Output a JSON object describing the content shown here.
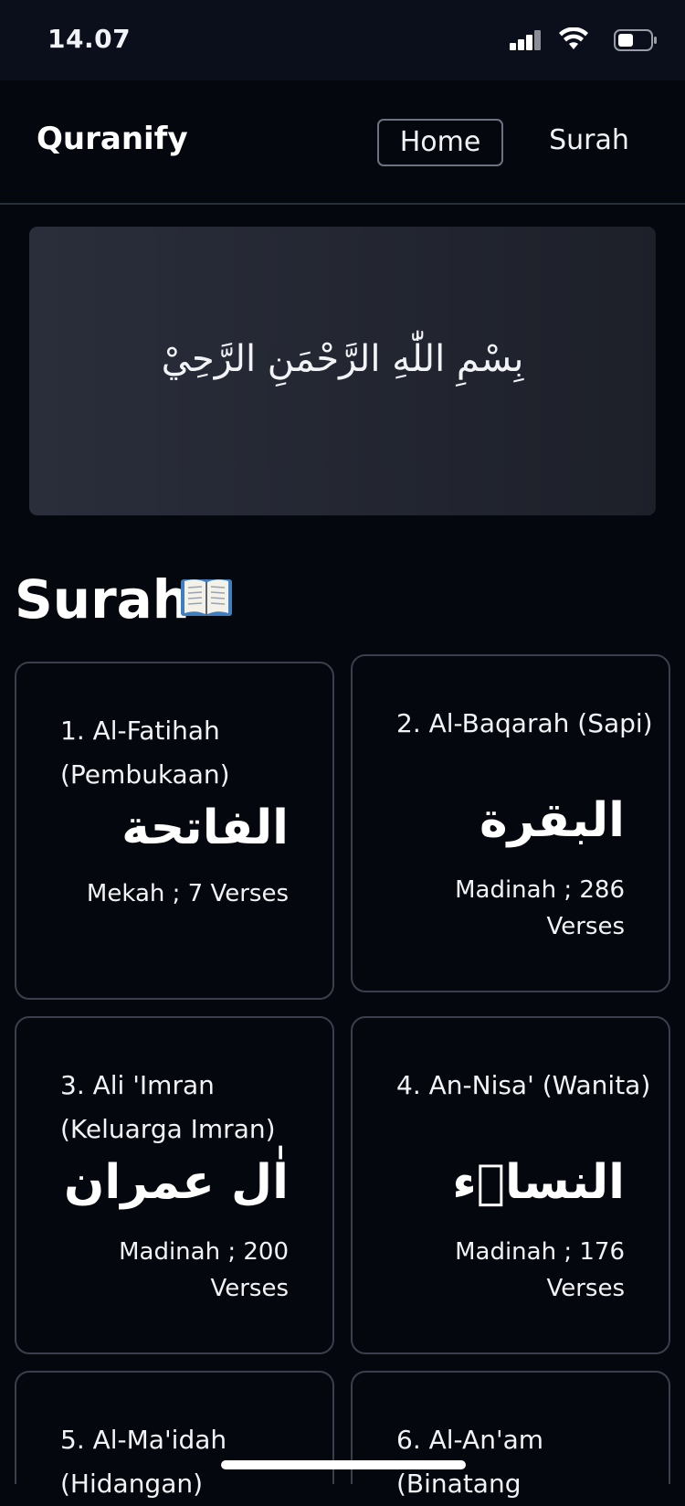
{
  "status": {
    "time": "14.07"
  },
  "nav": {
    "brand": "Quranify",
    "home": "Home",
    "surah": "Surah"
  },
  "bismillah": "بِسْمِ اللّٰهِ الرَّحْمَنِ الرَّحِيْ",
  "section": {
    "title": "Surah",
    "icon": "open-book-icon"
  },
  "surahs": [
    {
      "name": "1. Al-Fatihah (Pembukaan)",
      "arabic": "الفاتحة",
      "meta": "Mekah ; 7 Verses"
    },
    {
      "name": "2. Al-Baqarah (Sapi)",
      "arabic": "البقرة",
      "meta": "Madinah ; 286 Verses"
    },
    {
      "name": "3. Ali 'Imran (Keluarga Imran)",
      "arabic": "اٰل عمران",
      "meta": "Madinah ; 200 Verses"
    },
    {
      "name": "4. An-Nisa' (Wanita)",
      "arabic": "النساۤء",
      "meta": "Madinah ; 176 Verses"
    },
    {
      "name": "5. Al-Ma'idah (Hidangan)",
      "arabic": "",
      "meta": ""
    },
    {
      "name": "6. Al-An'am (Binatang",
      "arabic": "",
      "meta": ""
    }
  ],
  "colors": {
    "background": "#05070f",
    "card_border": "#3a3f4b",
    "text": "#f2f3f7"
  }
}
